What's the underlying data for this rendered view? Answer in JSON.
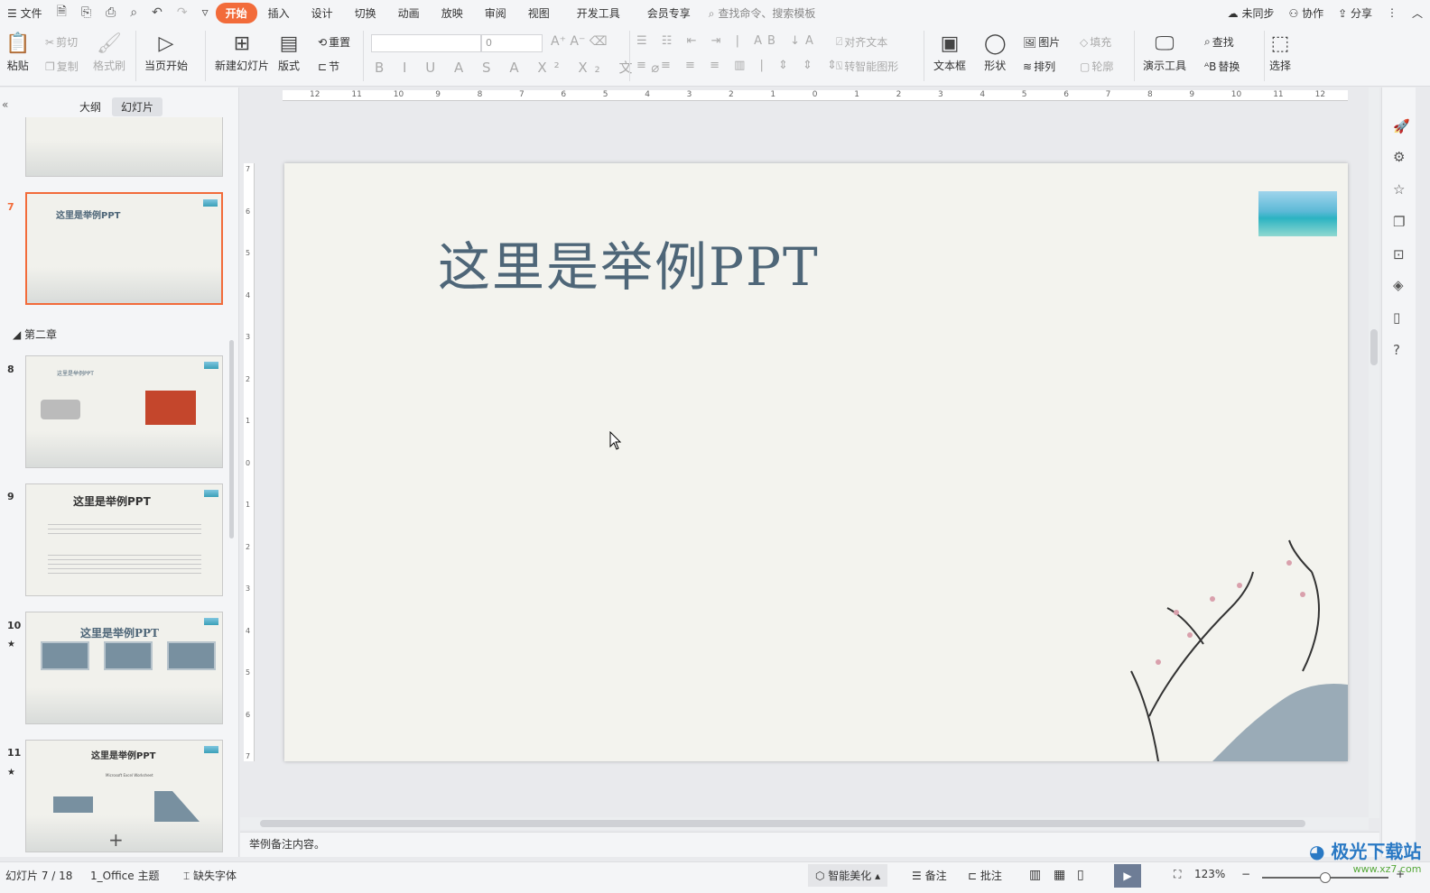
{
  "titlebar": {
    "menu": "文件",
    "tabs": [
      "开始",
      "插入",
      "设计",
      "切换",
      "动画",
      "放映",
      "审阅",
      "视图",
      "开发工具",
      "会员专享"
    ],
    "search_placeholder": "查找命令、搜索模板",
    "sync": "未同步",
    "collab": "协作",
    "share": "分享"
  },
  "ribbon": {
    "paste": "粘贴",
    "cut": "剪切",
    "copy": "复制",
    "format_painter": "格式刷",
    "play_from_current": "当页开始",
    "new_slide": "新建幻灯片",
    "layout": "版式",
    "reset": "重置",
    "section": "节",
    "font_size": "0",
    "align_text": "对齐文本",
    "smart_shape": "转智能图形",
    "textbox": "文本框",
    "shape": "形状",
    "picture": "图片",
    "fill": "填充",
    "arrange": "排列",
    "outline": "轮廓",
    "present_tools": "演示工具",
    "find": "查找",
    "replace": "替换",
    "select": "选择"
  },
  "panel": {
    "tabs": [
      "大纲",
      "幻灯片"
    ],
    "section": "第二章",
    "slides": [
      {
        "num": "7",
        "title": "这里是举例PPT"
      },
      {
        "num": "8",
        "title": "这里是举例PPT"
      },
      {
        "num": "9",
        "title": "这里是举例PPT"
      },
      {
        "num": "10",
        "title": "这里是举例PPT"
      },
      {
        "num": "11",
        "title": "这里是举例PPT",
        "sub": "Microsoft Excel Worksheet"
      }
    ],
    "add": "+"
  },
  "ruler": {
    "h": [
      "12",
      "11",
      "10",
      "9",
      "8",
      "7",
      "6",
      "5",
      "4",
      "3",
      "2",
      "1",
      "0",
      "1",
      "2",
      "3",
      "4",
      "5",
      "6",
      "7",
      "8",
      "9",
      "10",
      "11",
      "12"
    ],
    "v": [
      "7",
      "6",
      "5",
      "4",
      "3",
      "2",
      "1",
      "0",
      "1",
      "2",
      "3",
      "4",
      "5",
      "6",
      "7"
    ]
  },
  "slide": {
    "title": "这里是举例PPT"
  },
  "notes": "举例备注内容。",
  "status": {
    "slide": "幻灯片 7 / 18",
    "theme": "1_Office 主题",
    "missing_font": "缺失字体",
    "beautify": "智能美化",
    "notes": "备注",
    "comment": "批注",
    "zoom": "123%"
  },
  "watermark": {
    "text": "极光下载站",
    "url": "www.xz7.com"
  },
  "colors": {
    "accent": "#f26b3a",
    "title": "#4e6678"
  }
}
